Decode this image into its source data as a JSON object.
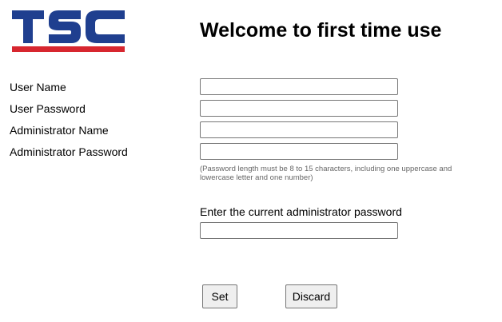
{
  "logo": {
    "text": "TSC",
    "colors": {
      "letters": "#1f3f8f",
      "bar": "#d7262f"
    }
  },
  "page_title": "Welcome to first time use",
  "form": {
    "user_name": {
      "label": "User Name",
      "value": ""
    },
    "user_password": {
      "label": "User Password",
      "value": ""
    },
    "admin_name": {
      "label": "Administrator Name",
      "value": ""
    },
    "admin_password": {
      "label": "Administrator Password",
      "value": ""
    },
    "password_hint": "(Password length must be 8 to 15 characters, including one uppercase and lowercase letter and one number)",
    "current_admin_password": {
      "label": "Enter the current administrator password",
      "value": ""
    }
  },
  "buttons": {
    "set": "Set",
    "discard": "Discard"
  }
}
